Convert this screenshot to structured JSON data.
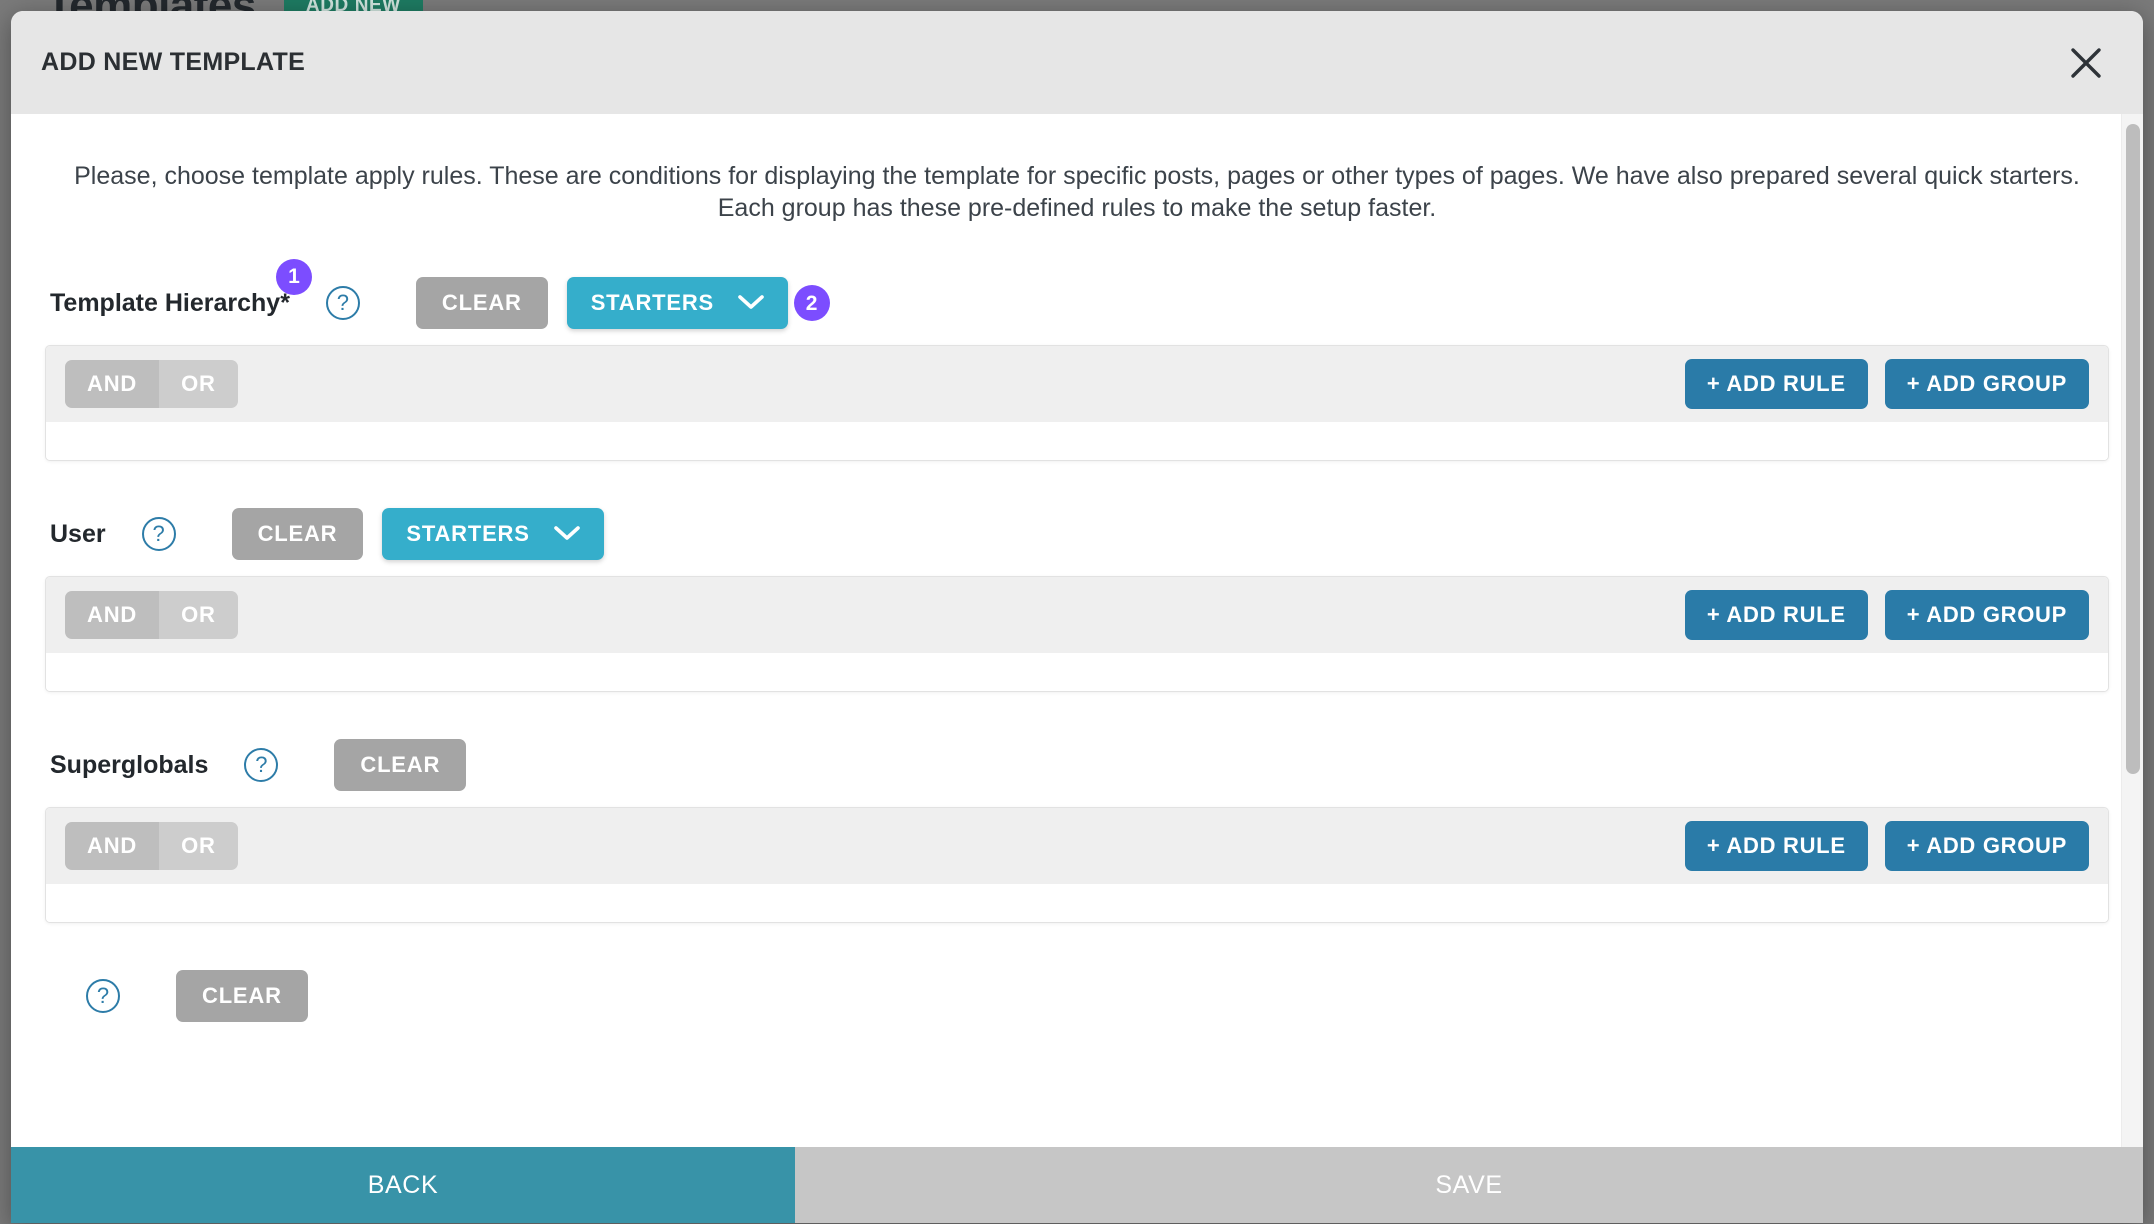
{
  "background": {
    "page_title": "Templates",
    "add_new_label": "ADD NEW"
  },
  "modal": {
    "title": "ADD NEW TEMPLATE",
    "close_icon": "close-icon",
    "intro": "Please, choose template apply rules. These are conditions for displaying the template for specific posts, pages or other types of pages. We have also prepared several quick starters. Each group has these pre-defined rules to make the setup faster."
  },
  "common": {
    "clear_label": "CLEAR",
    "starters_label": "STARTERS",
    "help_glyph": "?",
    "and_label": "AND",
    "or_label": "OR",
    "add_rule_label": "+ ADD RULE",
    "add_group_label": "+ ADD GROUP",
    "chevron_icon": "chevron-down-icon"
  },
  "sections": [
    {
      "label": "Template Hierarchy*",
      "has_help": true,
      "has_clear": true,
      "has_starters": true,
      "badge_label": "1",
      "starters_badge_label": "2",
      "active_operator": "AND"
    },
    {
      "label": "User",
      "has_help": true,
      "has_clear": true,
      "has_starters": true,
      "badge_label": null,
      "starters_badge_label": null,
      "active_operator": "AND"
    },
    {
      "label": "Superglobals",
      "has_help": true,
      "has_clear": true,
      "has_starters": false,
      "badge_label": null,
      "starters_badge_label": null,
      "active_operator": "AND"
    }
  ],
  "footer": {
    "back_label": "BACK",
    "save_label": "SAVE"
  },
  "colors": {
    "purple_badge": "#7c4dff",
    "starters_teal": "#35aecb",
    "blue_button": "#2a7ba8",
    "gray_button": "#a5a5a5",
    "footer_back": "#3893a8",
    "footer_save": "#c6c6c6",
    "help_outline": "#2d7ca8",
    "bg_add_new_green": "#1e7b62"
  },
  "scrollbar": {
    "name": "vertical-scrollbar"
  }
}
